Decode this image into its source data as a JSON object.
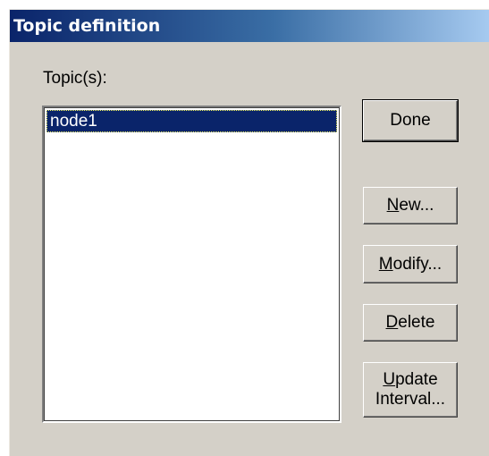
{
  "window": {
    "title": "Topic definition"
  },
  "topics": {
    "label": "Topic(s):",
    "items": [
      "node1"
    ],
    "selected_index": 0
  },
  "buttons": {
    "done": "Done",
    "new": {
      "mnemonic": "N",
      "rest": "ew..."
    },
    "modify": {
      "mnemonic": "M",
      "rest": "odify..."
    },
    "delete": {
      "mnemonic": "D",
      "rest": "elete"
    },
    "update": {
      "line1_mnemonic": "U",
      "line1_rest": "pdate",
      "line2": "Interval..."
    }
  },
  "colors": {
    "face": "#d4d0c8",
    "title_start": "#0a246a",
    "title_end": "#a6caf0",
    "selection": "#0a246a"
  }
}
